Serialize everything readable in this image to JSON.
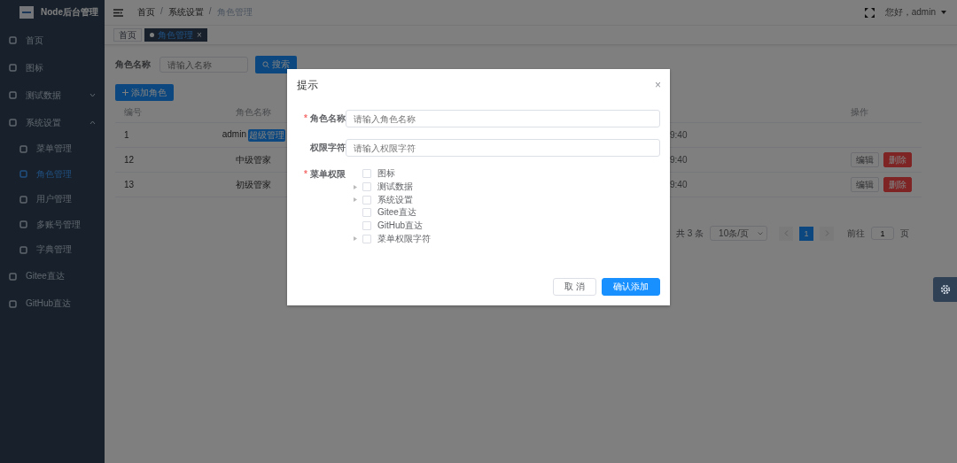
{
  "sidebar": {
    "title": "Node后台管理",
    "items": [
      {
        "label": "首页",
        "selected": false
      },
      {
        "label": "图标",
        "selected": false
      },
      {
        "label": "测试数据",
        "selected": false,
        "expanded": false
      },
      {
        "label": "系统设置",
        "selected": false,
        "expanded": true,
        "children": [
          {
            "label": "菜单管理",
            "selected": false
          },
          {
            "label": "角色管理",
            "selected": true
          },
          {
            "label": "用户管理",
            "selected": false
          },
          {
            "label": "多账号管理",
            "selected": false
          },
          {
            "label": "字典管理",
            "selected": false
          }
        ]
      },
      {
        "label": "Gitee直达",
        "selected": false
      },
      {
        "label": "GitHub直达",
        "selected": false
      }
    ]
  },
  "header": {
    "breadcrumb": [
      "首页",
      "系统设置",
      "角色管理"
    ],
    "separator": "/",
    "greeting": "您好，admin"
  },
  "tags": [
    {
      "label": "首页",
      "selected": false
    },
    {
      "label": "角色管理",
      "selected": true,
      "close": "×"
    }
  ],
  "search": {
    "label": "角色名称",
    "placeholder": "请输入名称",
    "button": "搜索"
  },
  "add_button": "添加角色",
  "table": {
    "columns": [
      {
        "label": "编号"
      },
      {
        "label": "角色名称"
      },
      {
        "label": "操作"
      }
    ],
    "rows": [
      {
        "id": "1",
        "name": "admin",
        "tag": "超级管理",
        "time": "9:40",
        "actions": []
      },
      {
        "id": "12",
        "name": "中级管家",
        "time": "9:40",
        "actions": [
          {
            "label": "编辑",
            "kind": "default"
          },
          {
            "label": "删除",
            "kind": "danger"
          }
        ]
      },
      {
        "id": "13",
        "name": "初级管家",
        "time": "9:40",
        "actions": [
          {
            "label": "编辑",
            "kind": "default"
          },
          {
            "label": "删除",
            "kind": "danger"
          }
        ]
      }
    ]
  },
  "pagination": {
    "total": "共 3 条",
    "page_size": "10条/页",
    "pages": [
      {
        "label": "1",
        "selected": true
      }
    ],
    "goto_label": "前往",
    "goto_value": "1",
    "goto_suffix": "页"
  },
  "dialog": {
    "title": "提示",
    "close": "×",
    "required_mark": "*",
    "fields": [
      {
        "label": "角色名称",
        "required": true,
        "placeholder": "请输入角色名称"
      },
      {
        "label": "权限字符",
        "required": false,
        "placeholder": "请输入权限字符"
      }
    ],
    "tree_label": "菜单权限",
    "tree_required": true,
    "tree": [
      {
        "label": "图标",
        "checked": false,
        "expandable": false
      },
      {
        "label": "测试数据",
        "checked": false,
        "expandable": true
      },
      {
        "label": "系统设置",
        "checked": false,
        "expandable": true
      },
      {
        "label": "Gitee直达",
        "checked": false,
        "expandable": false
      },
      {
        "label": "GitHub直达",
        "checked": false,
        "expandable": false
      },
      {
        "label": "菜单权限字符",
        "checked": false,
        "expandable": true
      }
    ],
    "buttons": [
      {
        "label": "取 消",
        "kind": "default"
      },
      {
        "label": "确认添加",
        "kind": "primary"
      }
    ]
  }
}
